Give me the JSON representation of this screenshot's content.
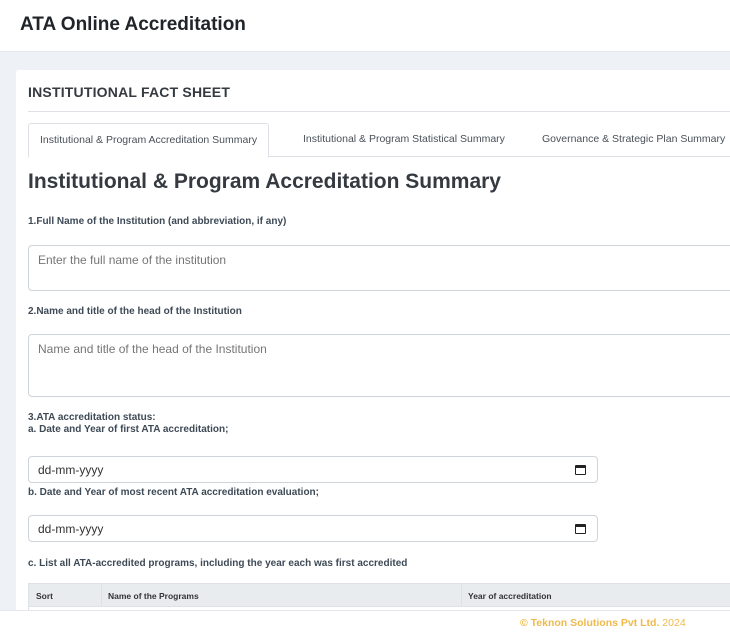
{
  "app": {
    "title": "ATA Online Accreditation"
  },
  "section": {
    "heading": "INSTITUTIONAL FACT SHEET"
  },
  "tabs": [
    {
      "label": "Institutional & Program Accreditation Summary",
      "active": true
    },
    {
      "label": "Institutional & Program Statistical Summary",
      "active": false
    },
    {
      "label": "Governance & Strategic Plan Summary",
      "active": false
    }
  ],
  "page": {
    "heading": "Institutional & Program Accreditation Summary"
  },
  "q1": {
    "label": "1.Full Name of the Institution (and abbreviation, if any)",
    "placeholder": "Enter the full name of the institution"
  },
  "q2": {
    "label": "2.Name and title of the head of the Institution",
    "placeholder": "Name and title of the head of the Institution"
  },
  "q3": {
    "label": "3.ATA accreditation status:",
    "a_label": "a. Date and Year of first ATA accreditation;",
    "a_value": "dd-mm-yyyy",
    "b_label": "b. Date and Year of most recent ATA accreditation evaluation;",
    "b_value": "dd-mm-yyyy",
    "c_label": "c. List all ATA-accredited programs, including the year each was first accredited"
  },
  "programs_table": {
    "columns": [
      "Sort",
      "Name of the Programs",
      "Year of accreditation"
    ]
  },
  "footer": {
    "company": "© Teknon Solutions Pvt Ltd.",
    "year": "2024"
  }
}
